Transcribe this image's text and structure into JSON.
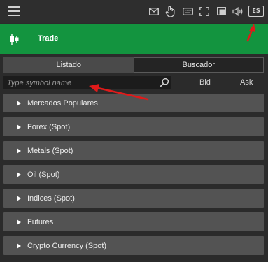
{
  "topbar": {
    "menu_icon": "hamburger-icon",
    "icons": [
      "mail-icon",
      "touch-hand-icon",
      "keyboard-icon",
      "fullscreen-icon",
      "window-icon",
      "volume-icon"
    ],
    "language_badge": "ES"
  },
  "header": {
    "title": "Trade",
    "icon": "candlestick-icon",
    "color": "#13943f"
  },
  "tabs": [
    {
      "label": "Listado",
      "active": true
    },
    {
      "label": "Buscador",
      "active": false
    }
  ],
  "search": {
    "placeholder": "Type symbol name",
    "value": ""
  },
  "columns": {
    "bid": "Bid",
    "ask": "Ask"
  },
  "categories": [
    {
      "label": "Mercados Populares"
    },
    {
      "label": "Forex (Spot)"
    },
    {
      "label": "Metals (Spot)"
    },
    {
      "label": "Oil (Spot)"
    },
    {
      "label": "Indices (Spot)"
    },
    {
      "label": "Futures"
    },
    {
      "label": "Crypto Currency (Spot)"
    }
  ],
  "annotation_color": "#e01a1a"
}
